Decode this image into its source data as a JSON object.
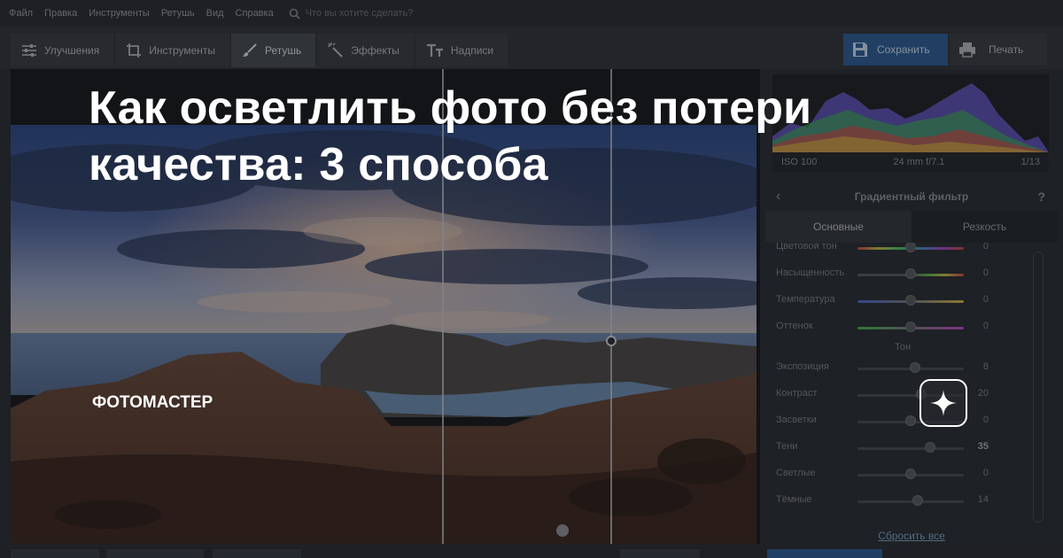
{
  "menu": {
    "items": [
      "Файл",
      "Правка",
      "Инструменты",
      "Ретушь",
      "Вид",
      "Справка"
    ],
    "search_placeholder": "Что вы хотите сделать?"
  },
  "toolbar": {
    "tabs": [
      {
        "label": "Улучшения",
        "icon": "sliders-icon"
      },
      {
        "label": "Инструменты",
        "icon": "crop-icon"
      },
      {
        "label": "Ретушь",
        "icon": "brush-icon",
        "active": true
      },
      {
        "label": "Эффекты",
        "icon": "magic-wand-icon"
      },
      {
        "label": "Надписи",
        "icon": "text-icon"
      }
    ],
    "save_label": "Сохранить",
    "print_label": "Печать",
    "accent_color": "#2e5e97"
  },
  "exif": {
    "iso": "ISO 100",
    "lens": "24 mm f/7.1",
    "shutter": "1/13"
  },
  "panel": {
    "title": "Градиентный фильтр",
    "back": "‹",
    "help": "?",
    "subtabs": [
      "Основные",
      "Резкость"
    ],
    "sliders_color": [
      {
        "label": "Цветовой тон",
        "value": "0",
        "level": 0.5
      },
      {
        "label": "Насыщенность",
        "value": "0",
        "level": 0.5
      },
      {
        "label": "Температура",
        "value": "0",
        "level": 0.5
      },
      {
        "label": "Оттенок",
        "value": "0",
        "level": 0.5
      }
    ],
    "section_tone": "Тон",
    "sliders_tone": [
      {
        "label": "Экспозиция",
        "value": "8",
        "level": 0.54
      },
      {
        "label": "Контраст",
        "value": "20",
        "level": 0.6
      },
      {
        "label": "Засветки",
        "value": "0",
        "level": 0.5
      },
      {
        "label": "Тени",
        "value": "35",
        "level": 0.68,
        "bold": true
      },
      {
        "label": "Светлые",
        "value": "0",
        "level": 0.5
      },
      {
        "label": "Тёмные",
        "value": "14",
        "level": 0.57
      }
    ],
    "reset_label": "Сбросить все"
  },
  "overlay": {
    "headline_line1": "Как осветлить фото без потери",
    "headline_line2": "качества: 3 способа",
    "brand": "ФОТОМАСТЕР"
  }
}
